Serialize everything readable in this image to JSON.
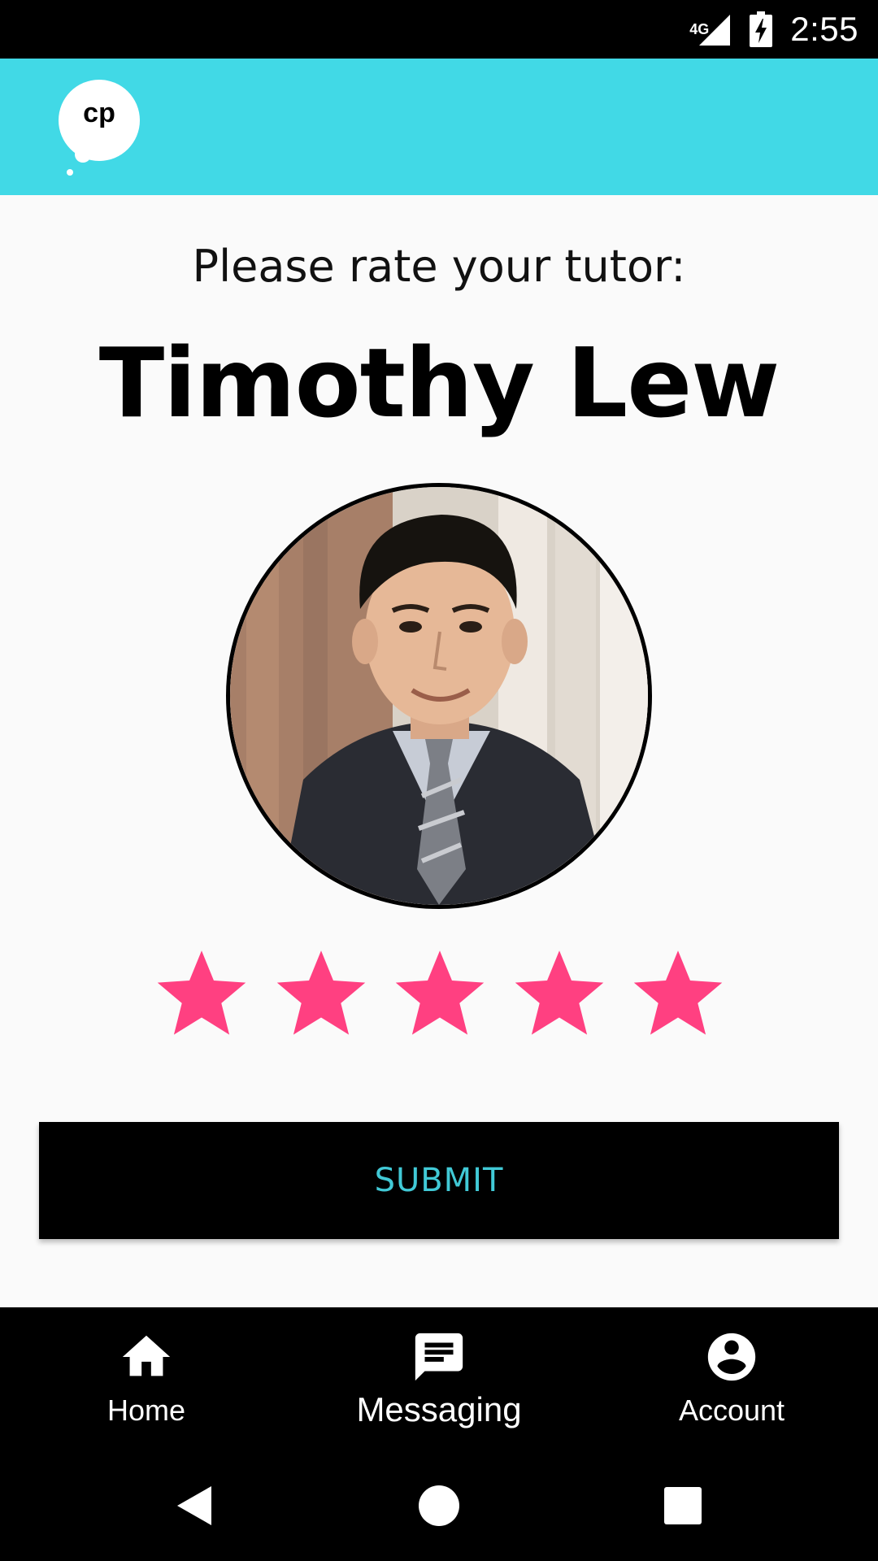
{
  "status_bar": {
    "network": "4G",
    "time": "2:55",
    "icons": [
      "signal-icon",
      "battery-charging-icon"
    ]
  },
  "app_bar": {
    "logo_text": "cp",
    "logo_icon": "speech-bubble-logo-icon",
    "color": "#41d9e6"
  },
  "rating_screen": {
    "prompt": "Please rate your tutor:",
    "tutor_name": "Timothy Lew",
    "star_count": 5,
    "selected_rating": 5,
    "star_color": "#ff4081",
    "submit_label": "SUBMIT",
    "submit_text_color": "#41c9d6"
  },
  "bottom_nav": {
    "items": [
      {
        "label": "Home",
        "icon": "home-icon"
      },
      {
        "label": "Messaging",
        "icon": "message-icon",
        "active": true
      },
      {
        "label": "Account",
        "icon": "account-circle-icon"
      }
    ]
  },
  "system_nav": {
    "icons": [
      "back-icon",
      "home-circle-icon",
      "recents-icon"
    ]
  }
}
